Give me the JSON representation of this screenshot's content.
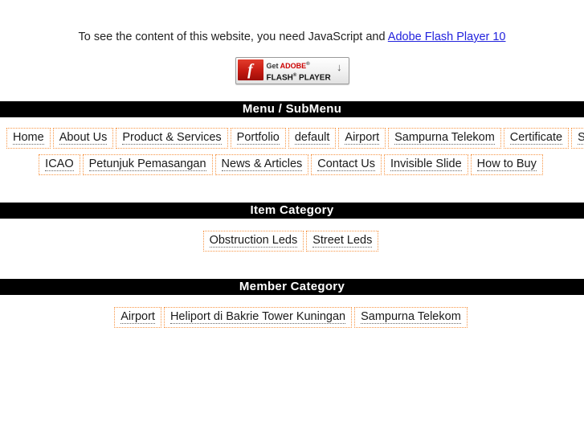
{
  "notice": {
    "text": "To see the content of this website, you need JavaScript and ",
    "link_label": "Adobe Flash Player 10",
    "link_color": "#2222dd"
  },
  "flash_badge": {
    "logo_glyph": "f",
    "line1_prefix": "Get ",
    "line1_brand": "ADOBE",
    "line1_sup": "®",
    "line2_word1": "FLASH",
    "line2_sup": "®",
    "line2_word2": " PLAYER",
    "arrow_glyph": "↓",
    "brand_color": "#cc0000",
    "logo_color": "#c51a12"
  },
  "sections": {
    "menu": {
      "title": "Menu / SubMenu",
      "row1": [
        {
          "label": "Home"
        },
        {
          "label": "About Us"
        },
        {
          "label": "Product & Services"
        },
        {
          "label": "Portfolio"
        },
        {
          "label": "default"
        },
        {
          "label": "Airport"
        },
        {
          "label": "Sampurna Telekom"
        },
        {
          "label": "Certificate"
        },
        {
          "label": "Sertifikat"
        }
      ],
      "row2": [
        {
          "label": "ICAO"
        },
        {
          "label": "Petunjuk Pemasangan"
        },
        {
          "label": "News & Articles"
        },
        {
          "label": "Contact Us"
        },
        {
          "label": "Invisible Slide"
        },
        {
          "label": "How to Buy"
        }
      ]
    },
    "item_category": {
      "title": "Item Category",
      "items": [
        {
          "label": "Obstruction Leds"
        },
        {
          "label": "Street Leds"
        }
      ]
    },
    "member_category": {
      "title": "Member Category",
      "items": [
        {
          "label": "Airport"
        },
        {
          "label": "Heliport di Bakrie Tower Kuningan"
        },
        {
          "label": "Sampurna Telekom"
        }
      ]
    }
  },
  "theme": {
    "bar_background": "#000000",
    "bar_text": "#ffffff",
    "item_border": "#f79646",
    "page_background": "#ffffff"
  }
}
